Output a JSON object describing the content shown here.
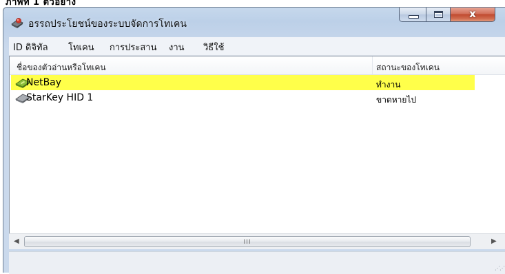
{
  "caption_fragment": "ภาพที่ 1 ตัวอย่าง",
  "window": {
    "title": "อรรถประโยชน์ของระบบจัดการโทเคน",
    "close_glyph": "x"
  },
  "menu": {
    "items": [
      "ID ดิจิทัล",
      "โทเคน",
      "การประสาน",
      "งาน",
      "วิธีใช้"
    ]
  },
  "list": {
    "columns": [
      "ชื่อของตัวอ่านหรือโทเคน",
      "สถานะของโทเคน"
    ],
    "rows": [
      {
        "name": "NetBay",
        "status": "ทำงาน",
        "selected": true,
        "icon": "token-device-icon"
      },
      {
        "name": "StarKey HID 1",
        "status": "ขาดหายไป",
        "selected": false,
        "icon": "token-device-icon"
      }
    ],
    "selected_color": "#ffff4a"
  },
  "scrollbar": {
    "left_arrow": "◀",
    "right_arrow": "▶",
    "grip": "III"
  },
  "statusbar": {
    "text": ""
  }
}
